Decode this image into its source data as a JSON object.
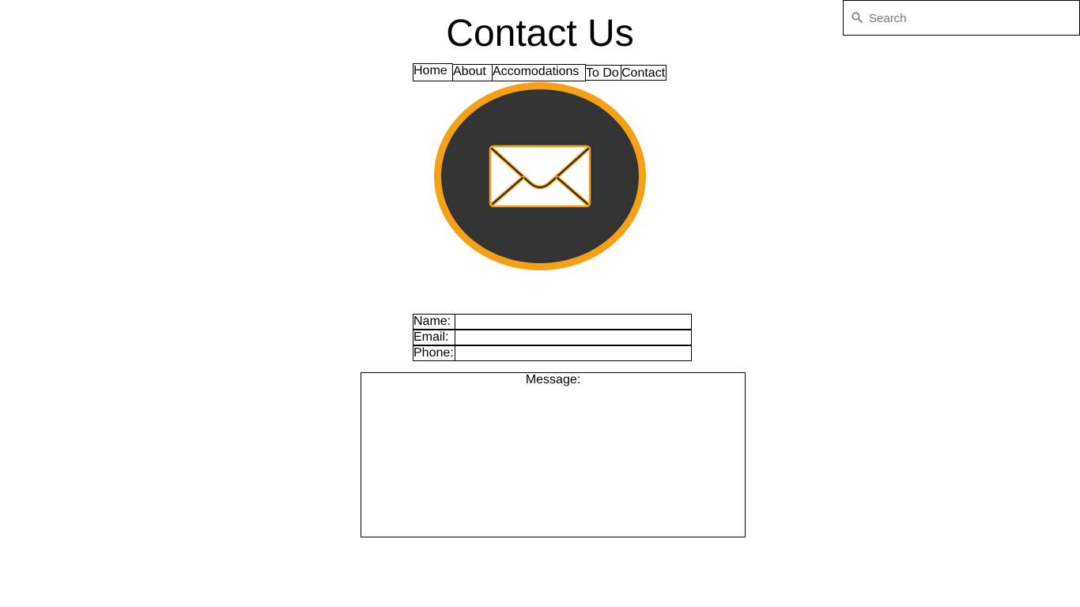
{
  "page": {
    "title": "Contact Us"
  },
  "search": {
    "placeholder": "Search",
    "value": ""
  },
  "nav": {
    "items": [
      {
        "label": "Home"
      },
      {
        "label": "About"
      },
      {
        "label": "Accomodations"
      },
      {
        "label": "To Do"
      },
      {
        "label": "Contact"
      }
    ]
  },
  "logo": {
    "icon": "envelope-icon",
    "ring_color": "#F5A117",
    "fill_color": "#333333"
  },
  "form": {
    "fields": [
      {
        "label": "Name:",
        "value": ""
      },
      {
        "label": "Email:",
        "value": ""
      },
      {
        "label": "Phone:",
        "value": ""
      }
    ],
    "message_label": "Message:",
    "message_value": ""
  }
}
